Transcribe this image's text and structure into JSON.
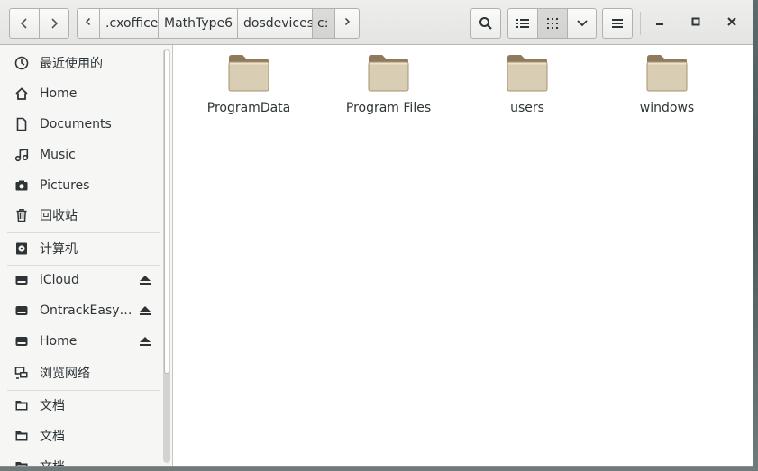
{
  "header": {
    "path": [
      {
        "label": ".cxoffice"
      },
      {
        "label": "MathType6"
      },
      {
        "label": "dosdevices"
      },
      {
        "label": "c:"
      }
    ]
  },
  "sidebar": {
    "items": [
      {
        "label": "最近使用的",
        "icon": "clock-icon"
      },
      {
        "label": "Home",
        "icon": "home-icon"
      },
      {
        "label": "Documents",
        "icon": "document-icon"
      },
      {
        "label": "Music",
        "icon": "music-icon"
      },
      {
        "label": "Pictures",
        "icon": "camera-icon"
      },
      {
        "label": "回收站",
        "icon": "trash-icon"
      },
      {
        "label": "计算机",
        "icon": "computer-icon"
      },
      {
        "label": "iCloud",
        "icon": "drive-icon",
        "eject": true
      },
      {
        "label": "OntrackEasy…",
        "icon": "drive-icon",
        "eject": true
      },
      {
        "label": "Home",
        "icon": "drive-icon",
        "eject": true
      },
      {
        "label": "浏览网络",
        "icon": "network-icon"
      },
      {
        "label": "文档",
        "icon": "folder-icon"
      },
      {
        "label": "文档",
        "icon": "folder-icon"
      },
      {
        "label": "文档",
        "icon": "folder-icon"
      }
    ]
  },
  "files": [
    {
      "name": "ProgramData",
      "icon": "folder-icon"
    },
    {
      "name": "Program Files",
      "icon": "folder-icon"
    },
    {
      "name": "users",
      "icon": "folder-icon"
    },
    {
      "name": "windows",
      "icon": "folder-icon"
    }
  ],
  "colors": {
    "folder_body": "#d9cdb4",
    "folder_tab": "#8f7a5c",
    "headerbar": "#e8e8e7",
    "sidebar_bg": "#f6f6f5"
  }
}
